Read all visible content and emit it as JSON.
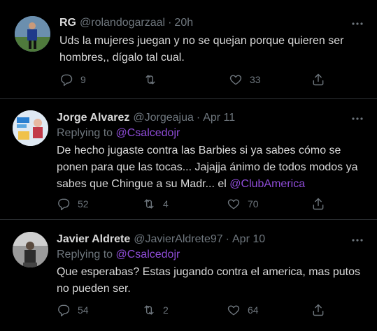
{
  "tweets": [
    {
      "name": "RG",
      "handle": "@rolandogarzaal",
      "separator": "·",
      "time": "20h",
      "replying_prefix": "",
      "replying_to": "",
      "text_parts": [
        "Uds la mujeres juegan y no se quejan porque quieren ser hombres,, dígalo tal cual."
      ],
      "replies": "9",
      "retweets": "",
      "likes": "33"
    },
    {
      "name": "Jorge Alvarez",
      "handle": "@Jorgeajua",
      "separator": "·",
      "time": "Apr 11",
      "replying_prefix": "Replying to",
      "replying_to": "@Csalcedojr",
      "text_parts": [
        "De hecho jugaste contra las Barbies si ya sabes cómo se ponen para que las tocas... Jajajja ánimo de todos modos ya sabes que Chingue a su Madr... el ",
        "@ClubAmerica"
      ],
      "replies": "52",
      "retweets": "4",
      "likes": "70"
    },
    {
      "name": "Javier Aldrete",
      "handle": "@JavierAldrete97",
      "separator": "·",
      "time": "Apr 10",
      "replying_prefix": "Replying to",
      "replying_to": "@Csalcedojr",
      "text_parts": [
        "Que esperabas? Estas jugando contra el america, mas putos no pueden ser."
      ],
      "replies": "54",
      "retweets": "2",
      "likes": "64"
    }
  ],
  "colors": {
    "background": "#000000",
    "text": "#d9d9d9",
    "secondary": "#6e767d",
    "mention": "#8f4cd8",
    "divider": "#2f3336"
  },
  "icons": [
    "more-icon",
    "reply-icon",
    "retweet-icon",
    "like-icon",
    "share-icon"
  ]
}
